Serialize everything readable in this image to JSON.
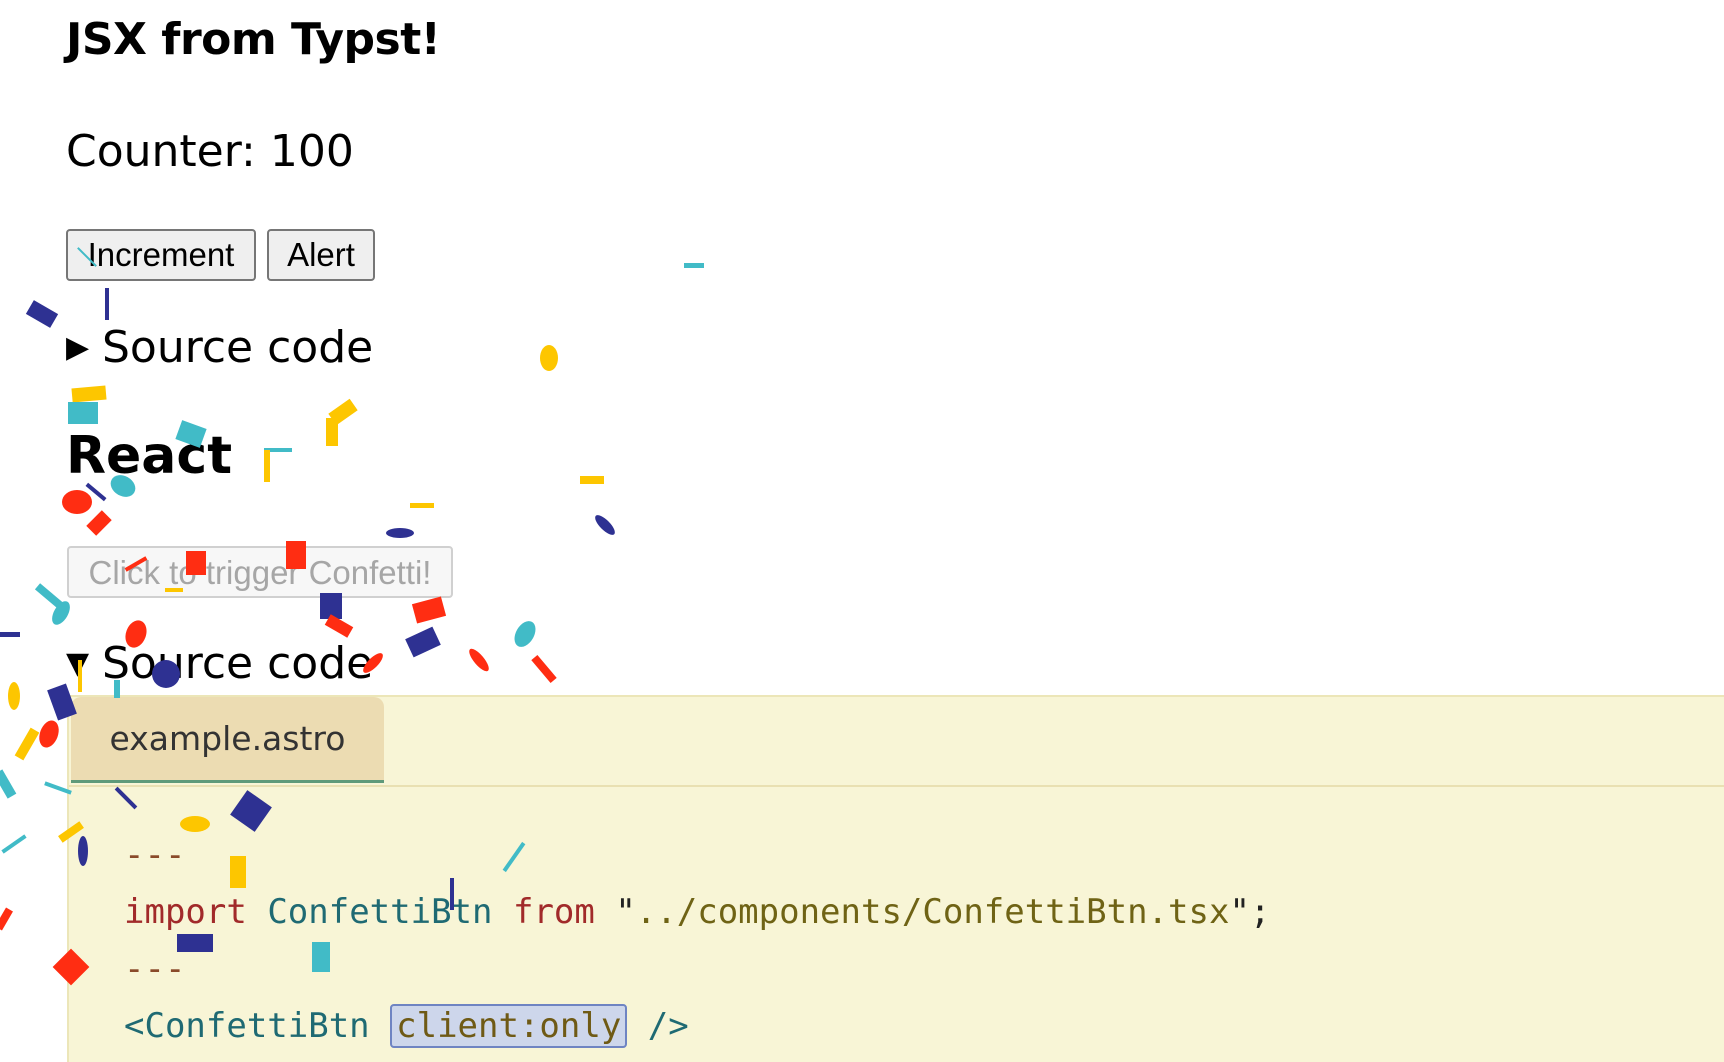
{
  "title": "JSX from Typst!",
  "counter_text": "Counter: 100",
  "buttons": {
    "increment": "Increment",
    "alert": "Alert"
  },
  "source_code_label_1": "Source code",
  "react_heading": "React",
  "confetti_button": "Click to trigger Confetti!",
  "source_code_label_2": "Source code",
  "code_panel": {
    "tab_label": "example.astro",
    "lines": [
      {
        "tokens": [
          {
            "t": "---",
            "c": "punc"
          }
        ]
      },
      {
        "tokens": [
          {
            "t": "import",
            "c": "kw"
          },
          {
            "t": " ",
            "c": "plain"
          },
          {
            "t": "ConfettiBtn",
            "c": "id"
          },
          {
            "t": " ",
            "c": "plain"
          },
          {
            "t": "from",
            "c": "kw"
          },
          {
            "t": " \"",
            "c": "plain"
          },
          {
            "t": "../components/ConfettiBtn.tsx",
            "c": "str"
          },
          {
            "t": "\";",
            "c": "plain"
          }
        ]
      },
      {
        "tokens": [
          {
            "t": "---",
            "c": "punc"
          }
        ]
      },
      {
        "tokens": [
          {
            "t": "<ConfettiBtn",
            "c": "tag"
          },
          {
            "t": " ",
            "c": "plain"
          },
          {
            "t": "client:only",
            "c": "attr"
          },
          {
            "t": " ",
            "c": "plain"
          },
          {
            "t": "/>",
            "c": "tag"
          }
        ]
      }
    ]
  },
  "colors": {
    "confetti_blue": "#2e3192",
    "confetti_teal": "#41bbc7",
    "confetti_yellow": "#fdc600",
    "confetti_red": "#ff2d12",
    "code_background": "#f8f5d6",
    "tab_background": "#ecdcb2"
  }
}
